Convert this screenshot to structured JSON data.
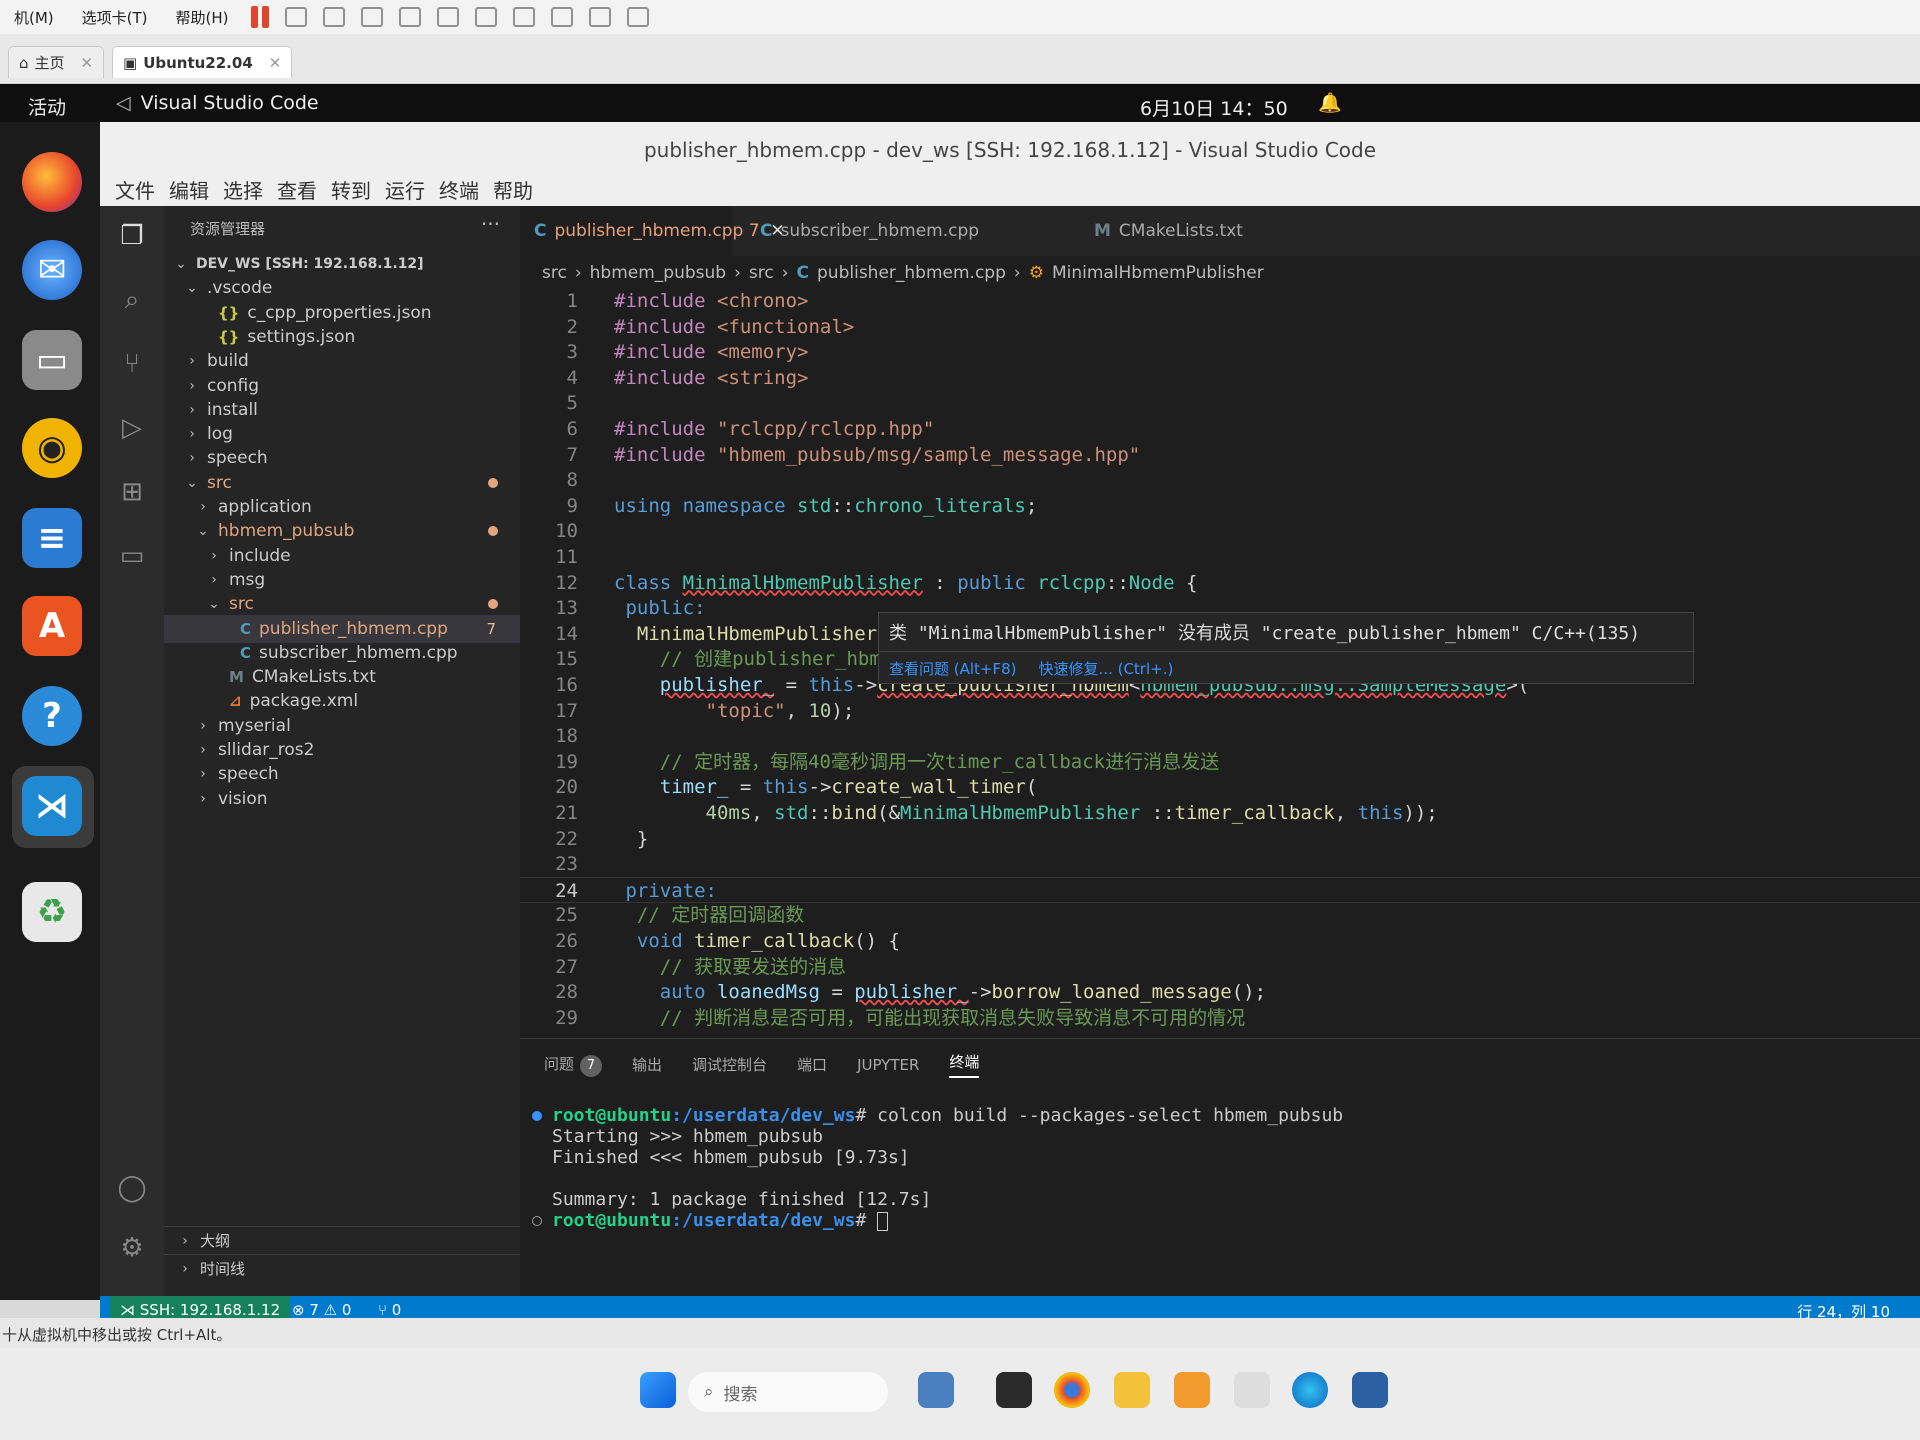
{
  "vmware": {
    "menus": [
      "机(M)",
      "选项卡(T)",
      "帮助(H)"
    ],
    "tabs": [
      {
        "label": "主页"
      },
      {
        "label": "Ubuntu22.04"
      }
    ],
    "hint": "十从虚拟机中移出或按 Ctrl+Alt。"
  },
  "ubuntu": {
    "activities": "活动",
    "app_name": "Visual Studio Code",
    "clock": "6月10日 14：50"
  },
  "window": {
    "title": "publisher_hbmem.cpp - dev_ws [SSH: 192.168.1.12] - Visual Studio Code",
    "menus": [
      "文件",
      "编辑",
      "选择",
      "查看",
      "转到",
      "运行",
      "终端",
      "帮助"
    ]
  },
  "explorer": {
    "title": "资源管理器",
    "more": "···",
    "footer": [
      "大纲",
      "时间线"
    ]
  },
  "tree": [
    {
      "label": "DEV_WS [SSH: 192.168.1.12]",
      "indent": 0,
      "chev": "v",
      "icon": "",
      "bold": true
    },
    {
      "label": ".vscode",
      "indent": 1,
      "chev": "v",
      "icon": ""
    },
    {
      "label": "c_cpp_properties.json",
      "indent": 2,
      "chev": "",
      "icon": "{}"
    },
    {
      "label": "settings.json",
      "indent": 2,
      "chev": "",
      "icon": "{}"
    },
    {
      "label": "build",
      "indent": 1,
      "chev": ">",
      "icon": ""
    },
    {
      "label": "config",
      "indent": 1,
      "chev": ">",
      "icon": ""
    },
    {
      "label": "install",
      "indent": 1,
      "chev": ">",
      "icon": ""
    },
    {
      "label": "log",
      "indent": 1,
      "chev": ">",
      "icon": ""
    },
    {
      "label": "speech",
      "indent": 1,
      "chev": ">",
      "icon": ""
    },
    {
      "label": "src",
      "indent": 1,
      "chev": "v",
      "icon": "",
      "color": "#e2a57e",
      "dot": true
    },
    {
      "label": "application",
      "indent": 2,
      "chev": ">",
      "icon": ""
    },
    {
      "label": "hbmem_pubsub",
      "indent": 2,
      "chev": "v",
      "icon": "",
      "color": "#e2a57e",
      "dot": true
    },
    {
      "label": "include",
      "indent": 3,
      "chev": ">",
      "icon": ""
    },
    {
      "label": "msg",
      "indent": 3,
      "chev": ">",
      "icon": ""
    },
    {
      "label": "src",
      "indent": 3,
      "chev": "v",
      "icon": "",
      "color": "#e2a57e",
      "dot": true
    },
    {
      "label": "publisher_hbmem.cpp",
      "indent": 4,
      "chev": "",
      "icon": "C",
      "color": "#e2a57e",
      "num": "7",
      "selected": true
    },
    {
      "label": "subscriber_hbmem.cpp",
      "indent": 4,
      "chev": "",
      "icon": "C"
    },
    {
      "label": "CMakeLists.txt",
      "indent": 3,
      "chev": "",
      "icon": "M"
    },
    {
      "label": "package.xml",
      "indent": 3,
      "chev": "",
      "icon": "rss"
    },
    {
      "label": "myserial",
      "indent": 2,
      "chev": ">",
      "icon": ""
    },
    {
      "label": "sllidar_ros2",
      "indent": 2,
      "chev": ">",
      "icon": ""
    },
    {
      "label": "speech",
      "indent": 2,
      "chev": ">",
      "icon": ""
    },
    {
      "label": "vision",
      "indent": 2,
      "chev": ">",
      "icon": ""
    }
  ],
  "tabs": [
    {
      "label": "publisher_hbmem.cpp",
      "count": "7",
      "active": true
    },
    {
      "label": "subscriber_hbmem.cpp"
    },
    {
      "label": "CMakeLists.txt"
    }
  ],
  "breadcrumb": [
    "src",
    "hbmem_pubsub",
    "src",
    "publisher_hbmem.cpp",
    "MinimalHbmemPublisher"
  ],
  "code": [
    [
      [
        "pp",
        "#include "
      ],
      [
        "str",
        "<chrono>"
      ]
    ],
    [
      [
        "pp",
        "#include "
      ],
      [
        "str",
        "<functional>"
      ]
    ],
    [
      [
        "pp",
        "#include "
      ],
      [
        "str",
        "<memory>"
      ]
    ],
    [
      [
        "pp",
        "#include "
      ],
      [
        "str",
        "<string>"
      ]
    ],
    [],
    [
      [
        "pp",
        "#include "
      ],
      [
        "str",
        "\"rclcpp/rclcpp.hpp\""
      ]
    ],
    [
      [
        "pp",
        "#include "
      ],
      [
        "str",
        "\"hbmem_pubsub/msg/sample_message.hpp\""
      ]
    ],
    [],
    [
      [
        "kw",
        "using namespace "
      ],
      [
        "ty",
        "std"
      ],
      [
        "",
        "::"
      ],
      [
        "ty",
        "chrono_literals"
      ],
      [
        "",
        ";"
      ]
    ],
    [],
    [],
    [
      [
        "kw",
        "class "
      ],
      [
        "ty squig",
        "MinimalHbmemPublisher"
      ],
      [
        "",
        " : "
      ],
      [
        "kw",
        "public "
      ],
      [
        "ty",
        "rclcpp"
      ],
      [
        "",
        "::"
      ],
      [
        "ty",
        "Node"
      ],
      [
        "",
        " {"
      ]
    ],
    [
      [
        "kw",
        " public:"
      ]
    ],
    [
      [
        "",
        "  "
      ],
      [
        "fn",
        "MinimalHbmemPublisher"
      ]
    ],
    [
      [
        "cm",
        "    // 创建publisher_hbm"
      ]
    ],
    [
      [
        "",
        "    "
      ],
      [
        "var squig",
        "publisher_"
      ],
      [
        "",
        " = "
      ],
      [
        "kw",
        "this"
      ],
      [
        "",
        "->"
      ],
      [
        "fn squig",
        "create_publisher_hbmem"
      ],
      [
        "",
        "<"
      ],
      [
        "ty squig",
        "hbmem_pubsub::msg::SampleMessage"
      ],
      [
        "",
        ">("
      ]
    ],
    [
      [
        "",
        "        "
      ],
      [
        "str",
        "\"topic\""
      ],
      [
        "",
        ", "
      ],
      [
        "num",
        "10"
      ],
      [
        "",
        ");"
      ]
    ],
    [],
    [
      [
        "cm",
        "    // 定时器，每隔40毫秒调用一次timer_callback进行消息发送"
      ]
    ],
    [
      [
        "",
        "    "
      ],
      [
        "var",
        "timer_"
      ],
      [
        "",
        " = "
      ],
      [
        "kw",
        "this"
      ],
      [
        "",
        "->"
      ],
      [
        "fn",
        "create_wall_timer"
      ],
      [
        "",
        "("
      ]
    ],
    [
      [
        "",
        "        "
      ],
      [
        "num",
        "40ms"
      ],
      [
        "",
        ", "
      ],
      [
        "ty",
        "std"
      ],
      [
        "",
        "::"
      ],
      [
        "fn",
        "bind"
      ],
      [
        "",
        "(&"
      ],
      [
        "ty",
        "MinimalHbmemPublisher"
      ],
      [
        "",
        " ::"
      ],
      [
        "fn",
        "timer_callback"
      ],
      [
        "",
        ", "
      ],
      [
        "kw",
        "this"
      ],
      [
        "",
        "));"
      ]
    ],
    [
      [
        "",
        "  }"
      ]
    ],
    [],
    [
      [
        "kw",
        " private:"
      ]
    ],
    [
      [
        "cm",
        "  // 定时器回调函数"
      ]
    ],
    [
      [
        "kw",
        "  void "
      ],
      [
        "fn",
        "timer_callback"
      ],
      [
        "",
        "() {"
      ]
    ],
    [
      [
        "cm",
        "    // 获取要发送的消息"
      ]
    ],
    [
      [
        "kw",
        "    auto "
      ],
      [
        "var",
        "loanedMsg"
      ],
      [
        "",
        " = "
      ],
      [
        "var squig",
        "publisher_"
      ],
      [
        "",
        "->"
      ],
      [
        "fn",
        "borrow_loaned_message"
      ],
      [
        "",
        "();"
      ]
    ],
    [
      [
        "cm",
        "    // 判断消息是否可用，可能出现获取消息失败导致消息不可用的情况"
      ]
    ]
  ],
  "hover": {
    "message": "类 \"MinimalHbmemPublisher\" 没有成员 \"create_publisher_hbmem\" C/C++(135)",
    "view_problem": "查看问题 (Alt+F8)",
    "quick_fix": "快速修复... (Ctrl+.)"
  },
  "panel": {
    "tabs": [
      "问题",
      "输出",
      "调试控制台",
      "端口",
      "JUPYTER",
      "终端"
    ],
    "problem_count": "7"
  },
  "terminal": {
    "prompt": "root@ubuntu",
    "path": ":/userdata/dev_ws",
    "command": "# colcon build --packages-select hbmem_pubsub",
    "lines": [
      "Starting >>> hbmem_pubsub",
      "Finished <<< hbmem_pubsub [9.73s]",
      "",
      "Summary: 1 package finished [12.7s]"
    ],
    "last_suffix": "# "
  },
  "status": {
    "remote": "SSH: 192.168.1.12",
    "problems": "⊗ 7 ⚠ 0",
    "ports": "⑂ 0",
    "cursor": "行 24，列 10"
  },
  "taskbar": {
    "search": "搜索"
  },
  "colors": {
    "accent": "#007acc",
    "modified": "#e2a57e",
    "remote": "#16825d"
  }
}
